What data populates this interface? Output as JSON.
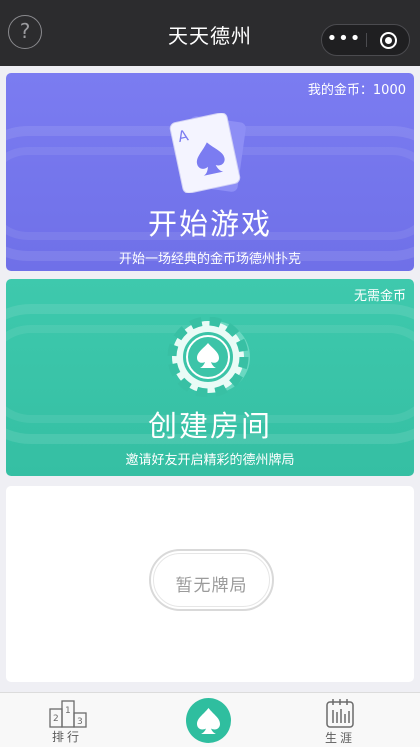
{
  "titlebar": {
    "title": "天天德州",
    "help_icon": "question-circle-icon",
    "more_icon": "more-dots-icon",
    "close_icon": "target-circle-icon",
    "more_glyph": "•••",
    "help_glyph": "?"
  },
  "start_card": {
    "coins_label": "我的金币：1000",
    "title": "开始游戏",
    "subtitle": "开始一场经典的金币场德州扑克",
    "card_letter": "A",
    "icon": "ace-of-spades-card-icon",
    "color": "#7173ea"
  },
  "create_card": {
    "badge": "无需金币",
    "title": "创建房间",
    "subtitle": "邀请好友开启精彩的德州牌局",
    "icon": "poker-chip-spade-icon",
    "color": "#3bc4a8"
  },
  "empty_card": {
    "text": "暂无牌局"
  },
  "tabbar": {
    "rank_label": "排行",
    "rank_icon": "podium-icon",
    "rank_numbers": [
      "2",
      "1",
      "3"
    ],
    "center_icon": "spade-icon",
    "center_color": "#2fbe9f",
    "career_label": "生涯",
    "career_icon": "calendar-icon"
  }
}
